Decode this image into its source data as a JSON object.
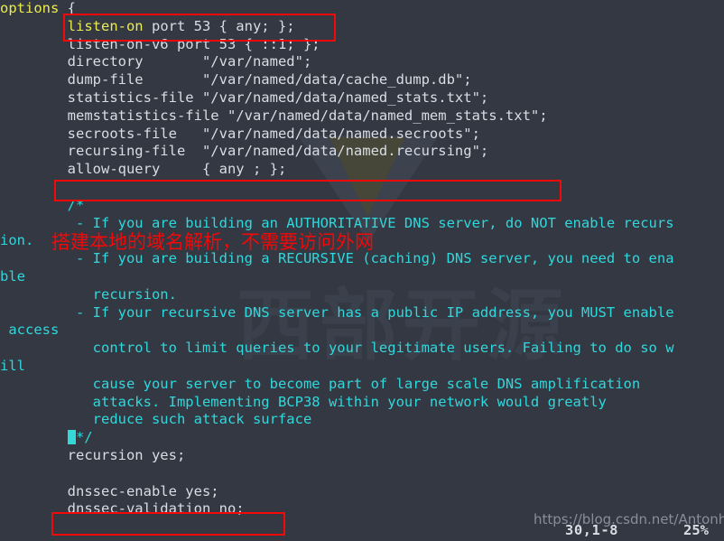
{
  "terminal": {
    "background_color": "#333842",
    "foreground_color": "#d8dee4",
    "comment_color": "#2fd8dc",
    "keyword_color": "#ecec52",
    "annotation_color": "#f40808",
    "lines": [
      {
        "id": "l01",
        "segments": [
          {
            "text": "options ",
            "cls": "c-yellow"
          },
          {
            "text": "{",
            "cls": "c-white"
          }
        ]
      },
      {
        "id": "l02",
        "segments": [
          {
            "text": "        ",
            "cls": "c-white"
          },
          {
            "text": "listen-on",
            "cls": "c-yellow"
          },
          {
            "text": " port 53 { any; };",
            "cls": "c-white"
          }
        ]
      },
      {
        "id": "l03",
        "segments": [
          {
            "text": "        listen-on-v6 port 53 { ::1; };",
            "cls": "c-white"
          }
        ]
      },
      {
        "id": "l04",
        "segments": [
          {
            "text": "        directory       \"/var/named\";",
            "cls": "c-white"
          }
        ]
      },
      {
        "id": "l05",
        "segments": [
          {
            "text": "        dump-file       \"/var/named/data/cache_dump.db\";",
            "cls": "c-white"
          }
        ]
      },
      {
        "id": "l06",
        "segments": [
          {
            "text": "        statistics-file \"/var/named/data/named_stats.txt\";",
            "cls": "c-white"
          }
        ]
      },
      {
        "id": "l07",
        "segments": [
          {
            "text": "        memstatistics-file \"/var/named/data/named_mem_stats.txt\";",
            "cls": "c-white"
          }
        ]
      },
      {
        "id": "l08",
        "segments": [
          {
            "text": "        secroots-file   \"/var/named/data/named.secroots\";",
            "cls": "c-white"
          }
        ]
      },
      {
        "id": "l09",
        "segments": [
          {
            "text": "        recursing-file  \"/var/named/data/named.recursing\";",
            "cls": "c-white"
          }
        ]
      },
      {
        "id": "l10",
        "segments": [
          {
            "text": "        allow-query     { any ; };",
            "cls": "c-white"
          }
        ]
      },
      {
        "id": "l11",
        "segments": [
          {
            "text": "",
            "cls": "c-white"
          }
        ]
      },
      {
        "id": "l12",
        "segments": [
          {
            "text": "        /*",
            "cls": "c-cmt"
          }
        ]
      },
      {
        "id": "l13",
        "segments": [
          {
            "text": "         - If you are building an AUTHORITATIVE DNS server, do NOT enable recurs",
            "cls": "c-cmt"
          }
        ]
      },
      {
        "id": "l14",
        "segments": [
          {
            "text": "ion.",
            "cls": "c-cmt"
          }
        ]
      },
      {
        "id": "l15",
        "segments": [
          {
            "text": "         - If you are building a RECURSIVE (caching) DNS server, you need to ena",
            "cls": "c-cmt"
          }
        ]
      },
      {
        "id": "l16",
        "segments": [
          {
            "text": "ble",
            "cls": "c-cmt"
          }
        ]
      },
      {
        "id": "l17",
        "segments": [
          {
            "text": "           recursion.",
            "cls": "c-cmt"
          }
        ]
      },
      {
        "id": "l18",
        "segments": [
          {
            "text": "         - If your recursive DNS server has a public IP address, you MUST enable",
            "cls": "c-cmt"
          }
        ]
      },
      {
        "id": "l19",
        "segments": [
          {
            "text": " access",
            "cls": "c-cmt"
          }
        ]
      },
      {
        "id": "l20",
        "segments": [
          {
            "text": "           control to limit queries to your legitimate users. Failing to do so w",
            "cls": "c-cmt"
          }
        ]
      },
      {
        "id": "l21",
        "segments": [
          {
            "text": "ill",
            "cls": "c-cmt"
          }
        ]
      },
      {
        "id": "l22",
        "segments": [
          {
            "text": "           cause your server to become part of large scale DNS amplification",
            "cls": "c-cmt"
          }
        ]
      },
      {
        "id": "l23",
        "segments": [
          {
            "text": "           attacks. Implementing BCP38 within your network would greatly",
            "cls": "c-cmt"
          }
        ]
      },
      {
        "id": "l24",
        "segments": [
          {
            "text": "           reduce such attack surface",
            "cls": "c-cmt"
          }
        ]
      },
      {
        "id": "l25",
        "cursor_at": 8,
        "segments": [
          {
            "text": "        ",
            "cls": "c-cmt"
          },
          {
            "text": "*/",
            "cls": "c-cmt"
          }
        ]
      },
      {
        "id": "l26",
        "segments": [
          {
            "text": "        recursion yes;",
            "cls": "c-white"
          }
        ]
      },
      {
        "id": "l27",
        "segments": [
          {
            "text": "",
            "cls": "c-white"
          }
        ]
      },
      {
        "id": "l28",
        "segments": [
          {
            "text": "        dnssec-enable yes;",
            "cls": "c-white"
          }
        ]
      },
      {
        "id": "l29",
        "segments": [
          {
            "text": "        dnssec-validation no;",
            "cls": "c-white"
          }
        ]
      }
    ]
  },
  "annotations": {
    "chinese_note": "搭建本地的域名解析，不需要访问外网",
    "boxes": [
      {
        "id": "redbox-listen-on",
        "target": "listen-on port 53 { any; };"
      },
      {
        "id": "redbox-comment",
        "target": "blank line above /*"
      },
      {
        "id": "redbox-dnssec",
        "target": "dnssec-validation no;"
      }
    ]
  },
  "watermarks": {
    "url": "https://blog.csdn.net/Antonhu",
    "logo_text": "西部开源"
  },
  "status_bar": {
    "position": "30,1-8",
    "percent": "25%"
  }
}
